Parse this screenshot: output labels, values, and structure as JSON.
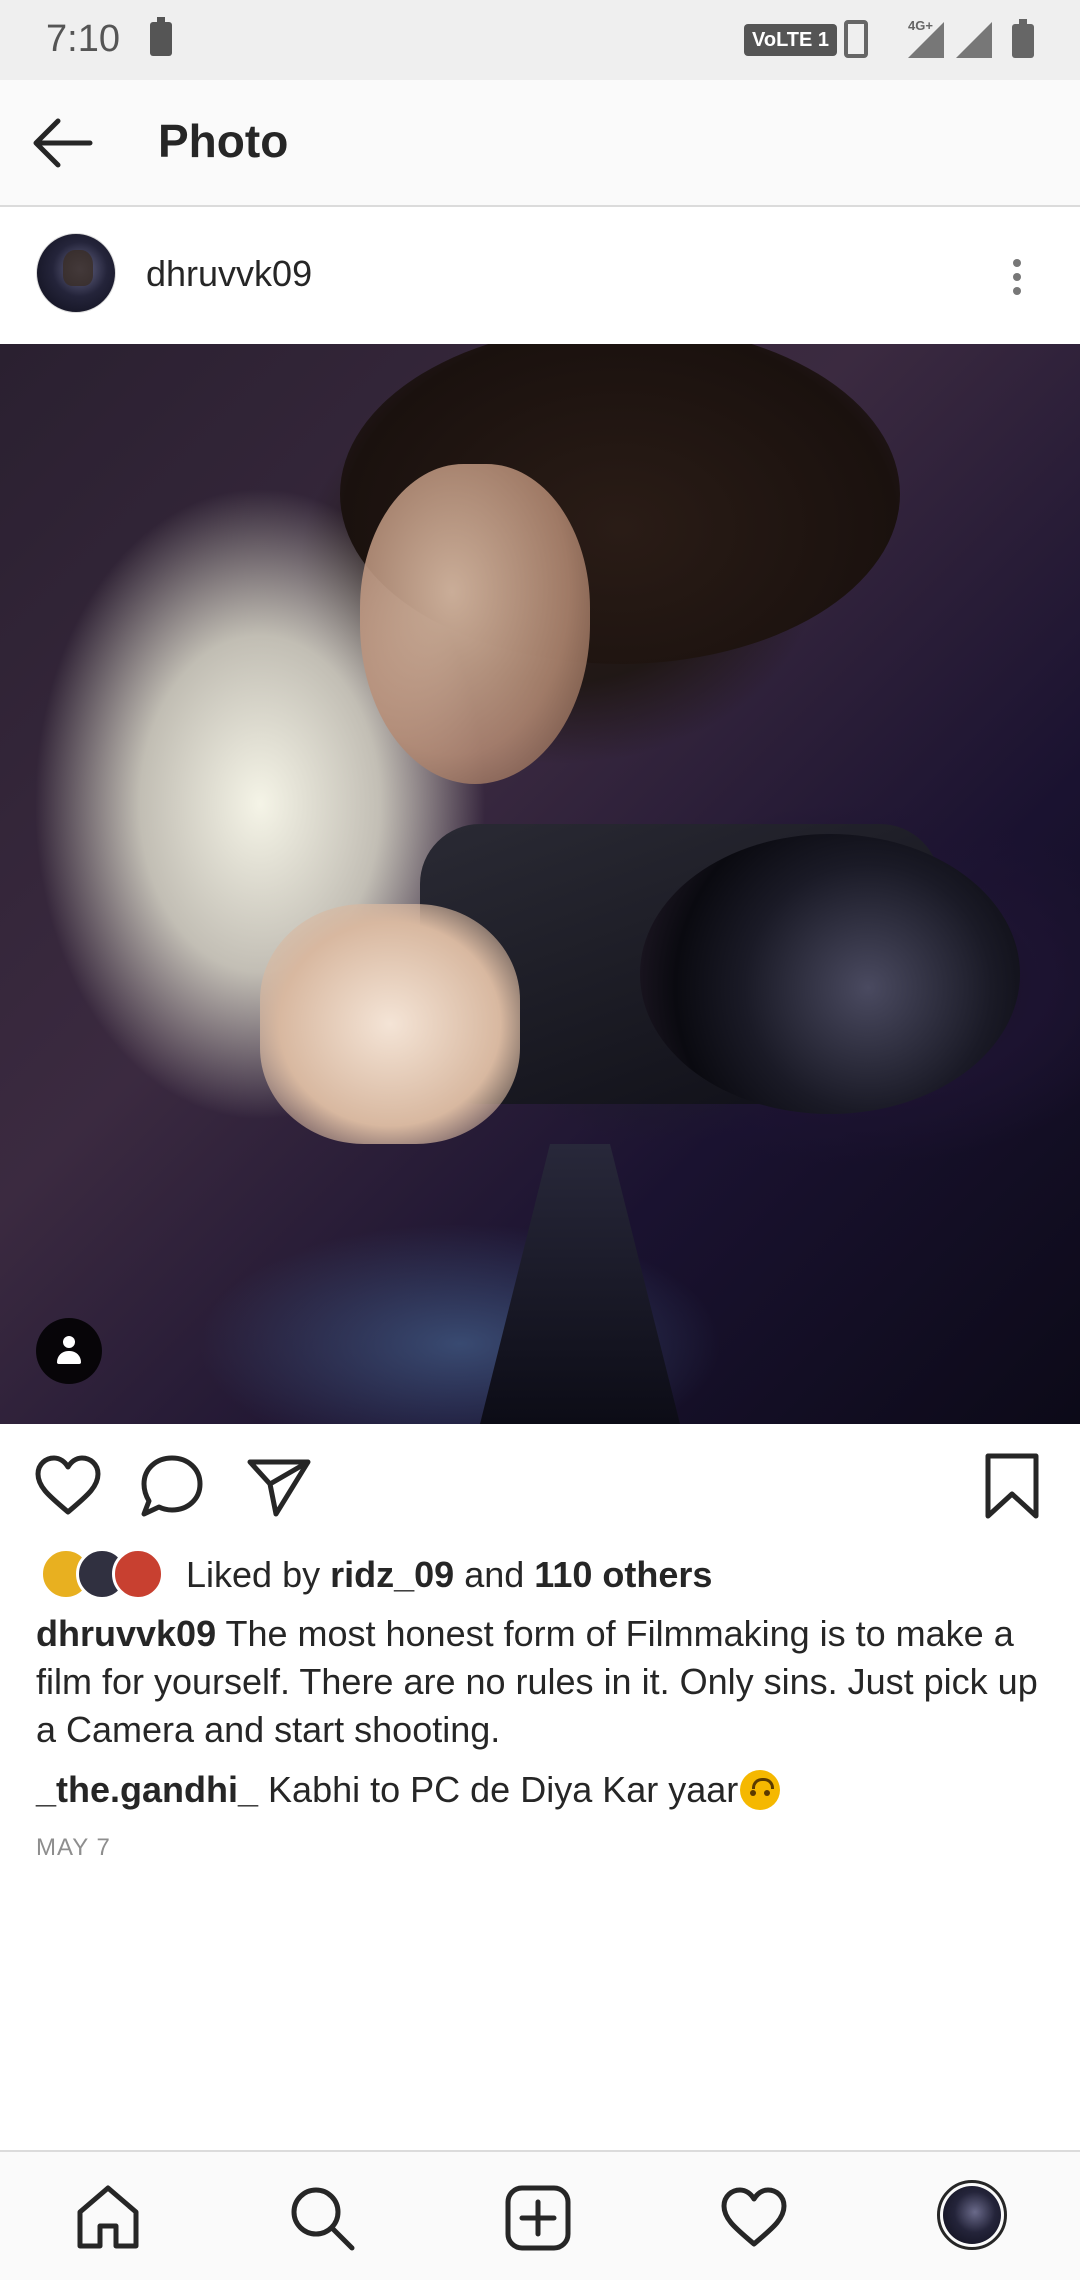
{
  "status_bar": {
    "time": "7:10",
    "network_badge": "VoLTE 1",
    "network_type": "4G+"
  },
  "header": {
    "title": "Photo",
    "back_icon": "arrow-left-icon"
  },
  "post": {
    "username": "dhruvvk09",
    "more_icon": "more-vertical-icon",
    "photo_alt": "photo",
    "actions": {
      "like_icon": "heart-icon",
      "comment_icon": "comment-icon",
      "share_icon": "send-icon",
      "save_icon": "bookmark-icon"
    },
    "likes": {
      "prefix": "Liked by",
      "user": "ridz_09",
      "joiner": "and",
      "others": "110 others",
      "avatar_colors": [
        "#e8b020",
        "#303040",
        "#c84030"
      ]
    },
    "caption": {
      "username": "dhruvvk09",
      "text": "The most honest form of Filmmaking is to make a film for yourself. There are no rules in it. Only sins. Just pick up a Camera and start shooting."
    },
    "comment": {
      "username": "_the.gandhi_",
      "text": "Kabhi to PC de Diya Kar yaar"
    },
    "date": "MAY 7"
  },
  "bottom_nav": {
    "items": [
      "home-icon",
      "search-icon",
      "add-post-icon",
      "activity-heart-icon",
      "profile-avatar"
    ]
  },
  "colors": {
    "text": "#262626",
    "muted": "#8e8e8e",
    "divider": "#dbdbdb",
    "status_bar_bg": "#efefef"
  }
}
